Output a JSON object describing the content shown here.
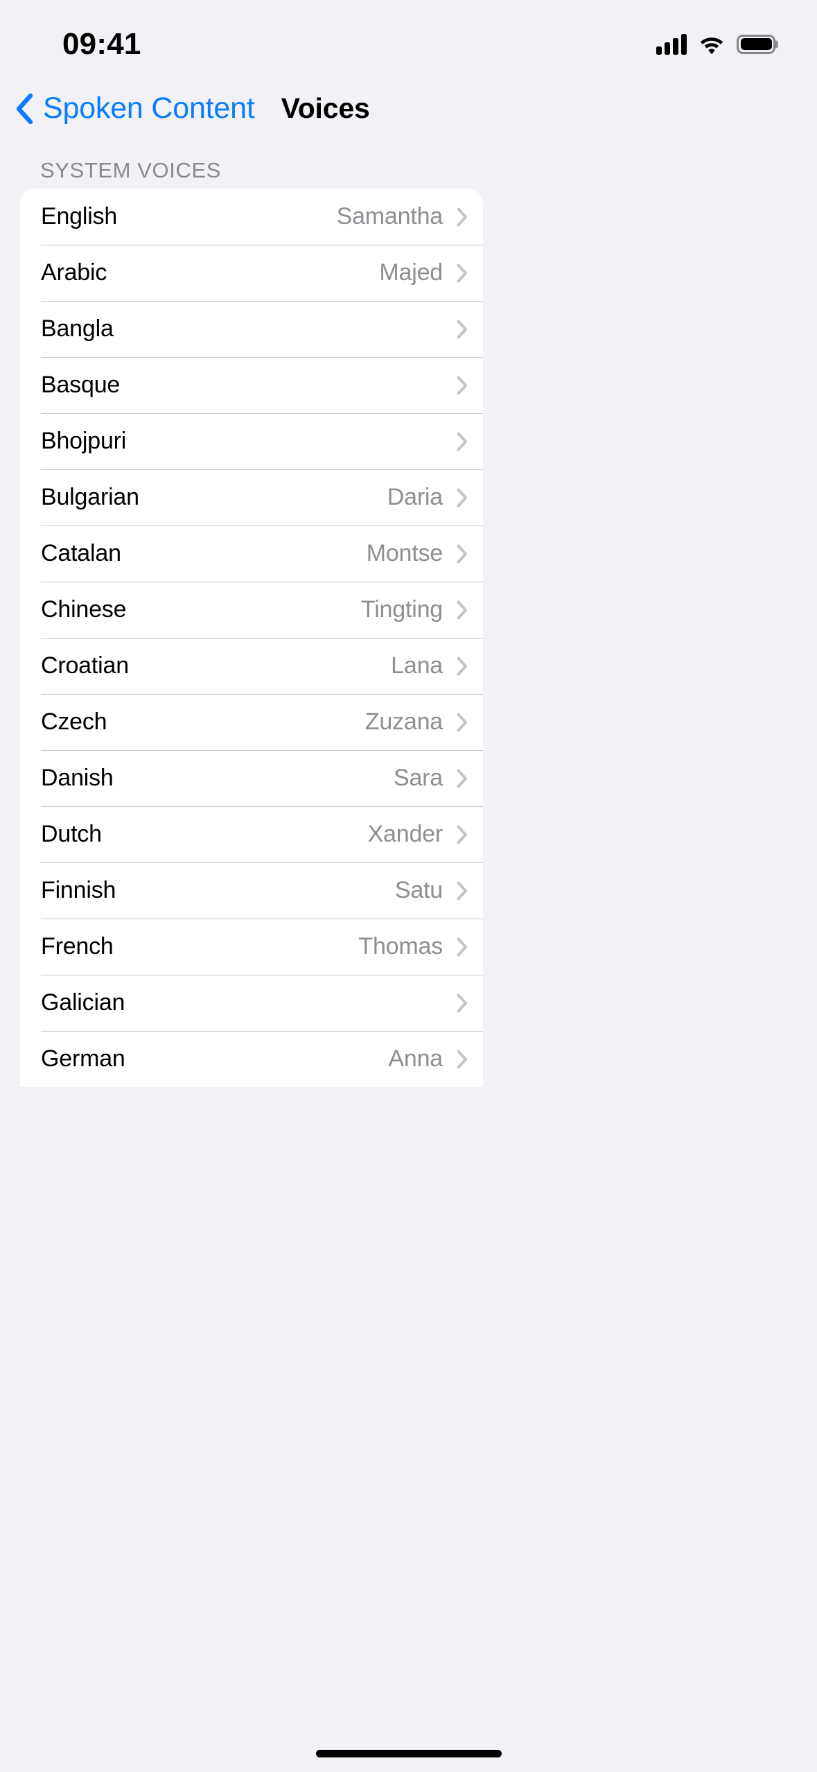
{
  "status_bar": {
    "time": "09:41",
    "icons": [
      "cellular-signal-icon",
      "wifi-icon",
      "battery-icon"
    ]
  },
  "nav": {
    "back_label": "Spoken Content",
    "back_icon": "chevron-left-icon",
    "title": "Voices",
    "accent_color": "#0a7cff"
  },
  "section": {
    "header": "SYSTEM VOICES"
  },
  "rows": [
    {
      "label": "English",
      "value": "Samantha",
      "chevron": "chevron-right-icon"
    },
    {
      "label": "Arabic",
      "value": "Majed",
      "chevron": "chevron-right-icon"
    },
    {
      "label": "Bangla",
      "value": "",
      "chevron": "chevron-right-icon"
    },
    {
      "label": "Basque",
      "value": "",
      "chevron": "chevron-right-icon"
    },
    {
      "label": "Bhojpuri",
      "value": "",
      "chevron": "chevron-right-icon"
    },
    {
      "label": "Bulgarian",
      "value": "Daria",
      "chevron": "chevron-right-icon"
    },
    {
      "label": "Catalan",
      "value": "Montse",
      "chevron": "chevron-right-icon"
    },
    {
      "label": "Chinese",
      "value": "Tingting",
      "chevron": "chevron-right-icon"
    },
    {
      "label": "Croatian",
      "value": "Lana",
      "chevron": "chevron-right-icon"
    },
    {
      "label": "Czech",
      "value": "Zuzana",
      "chevron": "chevron-right-icon"
    },
    {
      "label": "Danish",
      "value": "Sara",
      "chevron": "chevron-right-icon"
    },
    {
      "label": "Dutch",
      "value": "Xander",
      "chevron": "chevron-right-icon"
    },
    {
      "label": "Finnish",
      "value": "Satu",
      "chevron": "chevron-right-icon"
    },
    {
      "label": "French",
      "value": "Thomas",
      "chevron": "chevron-right-icon"
    },
    {
      "label": "Galician",
      "value": "",
      "chevron": "chevron-right-icon"
    },
    {
      "label": "German",
      "value": "Anna",
      "chevron": "chevron-right-icon"
    }
  ],
  "colors": {
    "page_background": "#f2f1f6",
    "card_background": "#ffffff",
    "separator": "#c6c6c8",
    "primary_text": "#000000",
    "secondary_text": "#8e8e93",
    "header_text": "#8a8a8e",
    "tint": "#0a7cff"
  }
}
